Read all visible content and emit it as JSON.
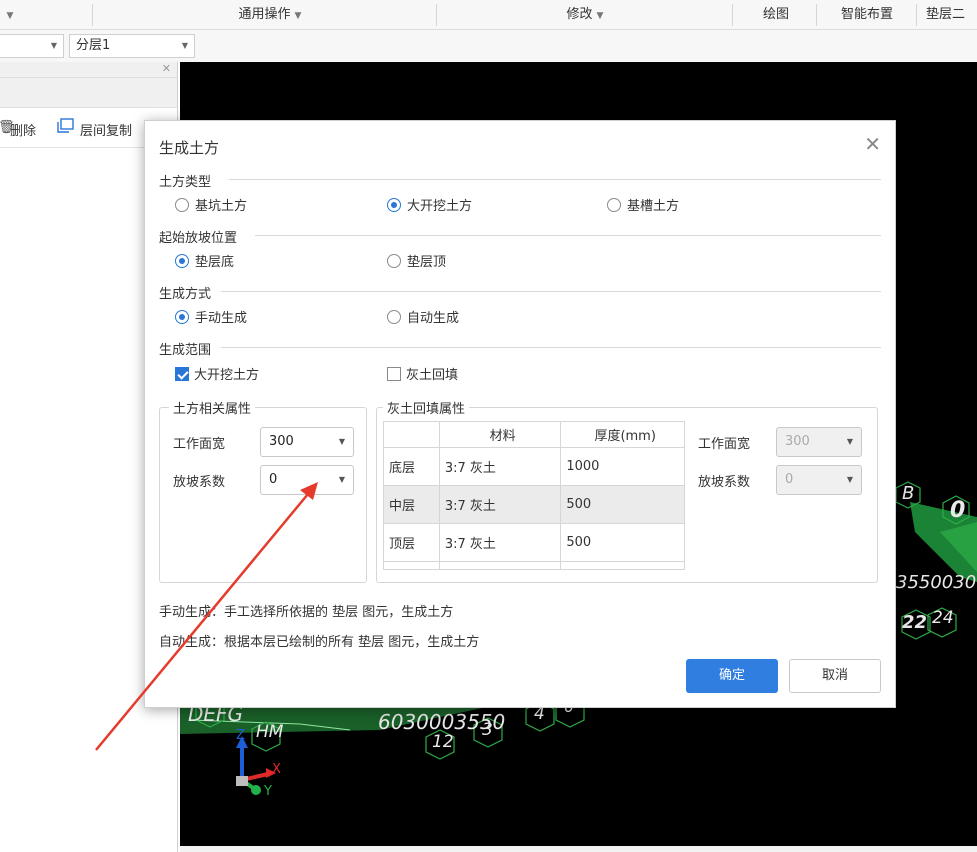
{
  "ribbon": {
    "general_ops": "通用操作",
    "modify": "修改",
    "draw": "绘图",
    "smart_layout": "智能布置",
    "cushion_two": "垫层二"
  },
  "layer_selector": {
    "value": "分层1"
  },
  "left_panel": {
    "delete_label": "删除",
    "copy_between_layers_label": "层间复制"
  },
  "canvas": {
    "labels": [
      "B",
      "0",
      "DEFG",
      "HM",
      "6030003550",
      "12",
      "3",
      "4",
      "6",
      "3550030",
      "22",
      "24"
    ],
    "axes": {
      "x": "X",
      "y": "Y",
      "z": "Z"
    }
  },
  "dialog": {
    "title": "生成土方",
    "earth_type": {
      "label": "土方类型",
      "options": [
        "基坑土方",
        "大开挖土方",
        "基槽土方"
      ],
      "selected": "大开挖土方"
    },
    "slope_start": {
      "label": "起始放坡位置",
      "options": [
        "垫层底",
        "垫层顶"
      ],
      "selected": "垫层底"
    },
    "gen_mode": {
      "label": "生成方式",
      "options": [
        "手动生成",
        "自动生成"
      ],
      "selected": "手动生成"
    },
    "gen_range": {
      "label": "生成范围",
      "options": [
        "大开挖土方",
        "灰土回填"
      ],
      "checked": [
        true,
        false
      ]
    },
    "earth_props": {
      "legend": "土方相关属性",
      "work_width_label": "工作面宽",
      "work_width_value": "300",
      "slope_coef_label": "放坡系数",
      "slope_coef_value": "0"
    },
    "fill_props": {
      "legend": "灰土回填属性",
      "columns": [
        "",
        "材料",
        "厚度(mm)"
      ],
      "rows": [
        {
          "layer": "底层",
          "material": "3:7 灰土",
          "thickness": "1000"
        },
        {
          "layer": "中层",
          "material": "3:7 灰土",
          "thickness": "500"
        },
        {
          "layer": "顶层",
          "material": "3:7 灰土",
          "thickness": "500"
        }
      ],
      "work_width_label": "工作面宽",
      "work_width_value": "300",
      "slope_coef_label": "放坡系数",
      "slope_coef_value": "0"
    },
    "notes": [
      "手动生成：手工选择所依据的 垫层 图元，生成土方",
      "自动生成：根据本层已绘制的所有 垫层 图元，生成土方"
    ],
    "ok_label": "确定",
    "cancel_label": "取消"
  },
  "colors": {
    "primary_button": "#2f7ee0",
    "radio_accent": "#2a76d8",
    "annotation_arrow": "#e53b2c",
    "canvas_bg": "#000000",
    "cad_green": "#2fae4a"
  },
  "annotation": {
    "type": "red-arrow",
    "points_to": "slope-coef-dropdown"
  }
}
